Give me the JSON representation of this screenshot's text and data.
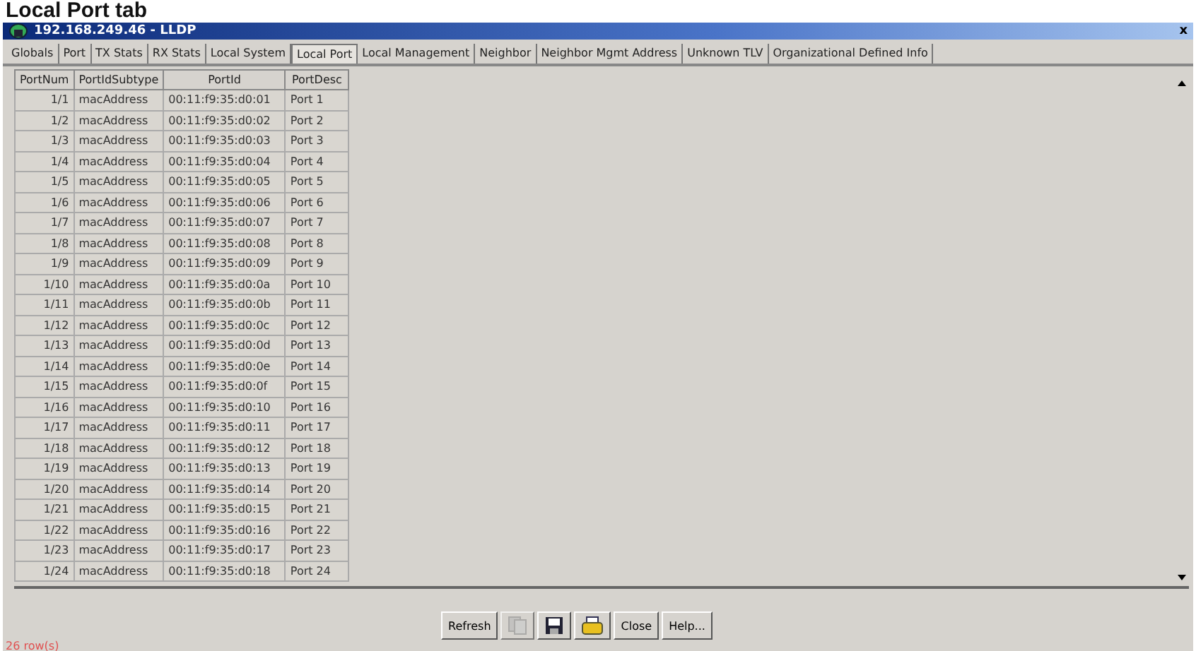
{
  "heading": "Local Port tab",
  "window": {
    "title": "192.168.249.46 - LLDP",
    "close": "x"
  },
  "tabs": [
    {
      "label": "Globals",
      "selected": false
    },
    {
      "label": "Port",
      "selected": false
    },
    {
      "label": "TX Stats",
      "selected": false
    },
    {
      "label": "RX Stats",
      "selected": false
    },
    {
      "label": "Local System",
      "selected": false
    },
    {
      "label": "Local Port",
      "selected": true
    },
    {
      "label": "Local Management",
      "selected": false
    },
    {
      "label": "Neighbor",
      "selected": false
    },
    {
      "label": "Neighbor Mgmt Address",
      "selected": false
    },
    {
      "label": "Unknown TLV",
      "selected": false
    },
    {
      "label": "Organizational Defined Info",
      "selected": false
    }
  ],
  "table": {
    "columns": [
      "PortNum",
      "PortIdSubtype",
      "PortId",
      "PortDesc"
    ],
    "rows": [
      [
        "1/1",
        "macAddress",
        "00:11:f9:35:d0:01",
        "Port 1"
      ],
      [
        "1/2",
        "macAddress",
        "00:11:f9:35:d0:02",
        "Port 2"
      ],
      [
        "1/3",
        "macAddress",
        "00:11:f9:35:d0:03",
        "Port 3"
      ],
      [
        "1/4",
        "macAddress",
        "00:11:f9:35:d0:04",
        "Port 4"
      ],
      [
        "1/5",
        "macAddress",
        "00:11:f9:35:d0:05",
        "Port 5"
      ],
      [
        "1/6",
        "macAddress",
        "00:11:f9:35:d0:06",
        "Port 6"
      ],
      [
        "1/7",
        "macAddress",
        "00:11:f9:35:d0:07",
        "Port 7"
      ],
      [
        "1/8",
        "macAddress",
        "00:11:f9:35:d0:08",
        "Port 8"
      ],
      [
        "1/9",
        "macAddress",
        "00:11:f9:35:d0:09",
        "Port 9"
      ],
      [
        "1/10",
        "macAddress",
        "00:11:f9:35:d0:0a",
        "Port 10"
      ],
      [
        "1/11",
        "macAddress",
        "00:11:f9:35:d0:0b",
        "Port 11"
      ],
      [
        "1/12",
        "macAddress",
        "00:11:f9:35:d0:0c",
        "Port 12"
      ],
      [
        "1/13",
        "macAddress",
        "00:11:f9:35:d0:0d",
        "Port 13"
      ],
      [
        "1/14",
        "macAddress",
        "00:11:f9:35:d0:0e",
        "Port 14"
      ],
      [
        "1/15",
        "macAddress",
        "00:11:f9:35:d0:0f",
        "Port 15"
      ],
      [
        "1/16",
        "macAddress",
        "00:11:f9:35:d0:10",
        "Port 16"
      ],
      [
        "1/17",
        "macAddress",
        "00:11:f9:35:d0:11",
        "Port 17"
      ],
      [
        "1/18",
        "macAddress",
        "00:11:f9:35:d0:12",
        "Port 18"
      ],
      [
        "1/19",
        "macAddress",
        "00:11:f9:35:d0:13",
        "Port 19"
      ],
      [
        "1/20",
        "macAddress",
        "00:11:f9:35:d0:14",
        "Port 20"
      ],
      [
        "1/21",
        "macAddress",
        "00:11:f9:35:d0:15",
        "Port 21"
      ],
      [
        "1/22",
        "macAddress",
        "00:11:f9:35:d0:16",
        "Port 22"
      ],
      [
        "1/23",
        "macAddress",
        "00:11:f9:35:d0:17",
        "Port 23"
      ],
      [
        "1/24",
        "macAddress",
        "00:11:f9:35:d0:18",
        "Port 24"
      ]
    ]
  },
  "buttons": [
    {
      "kind": "text",
      "label": "Refresh",
      "disabled": false
    },
    {
      "kind": "copy",
      "disabled": true
    },
    {
      "kind": "save",
      "disabled": false
    },
    {
      "kind": "print",
      "disabled": false
    },
    {
      "kind": "text",
      "label": "Close",
      "disabled": false
    },
    {
      "kind": "text",
      "label": "Help...",
      "disabled": false
    }
  ],
  "status_bar": "26 row(s)"
}
